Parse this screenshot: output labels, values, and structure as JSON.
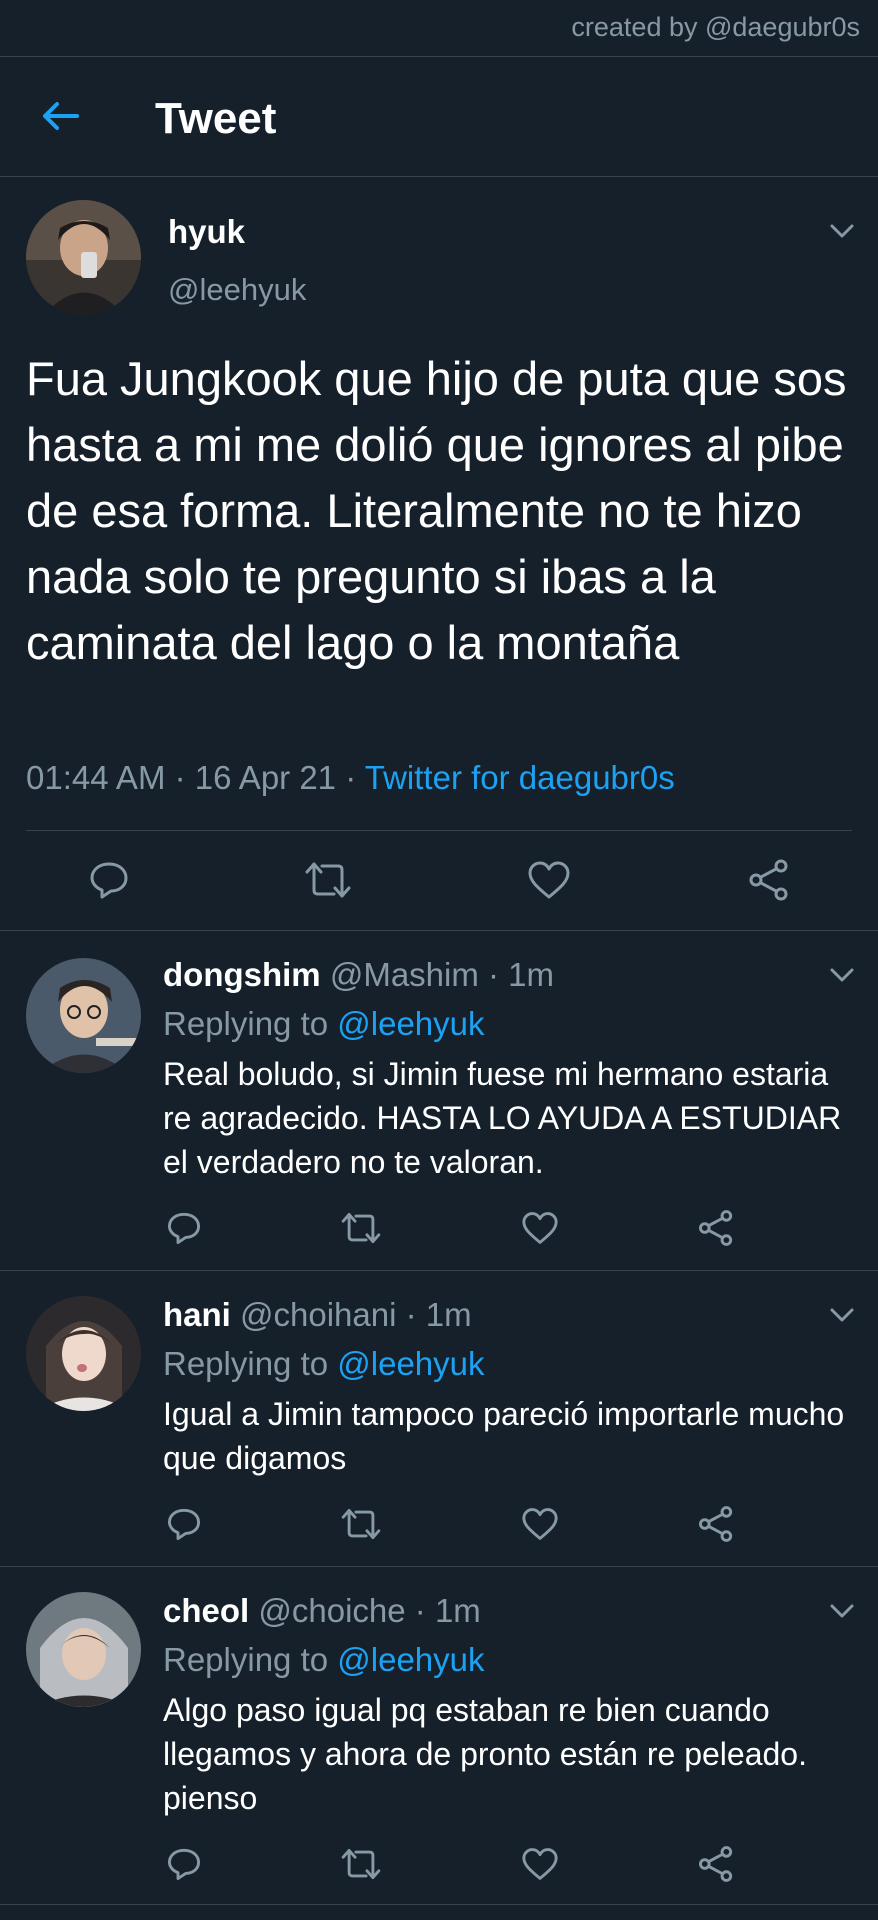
{
  "credit": "created by @daegubr0s",
  "header": {
    "title": "Tweet"
  },
  "main_tweet": {
    "name": "hyuk",
    "handle": "@leehyuk",
    "text": "Fua Jungkook que hijo de puta que sos hasta a mi me dolió que ignores al pibe de esa forma. Literalmente no te hizo nada solo te pregunto si ibas a la caminata del lago o la montaña",
    "time": "01:44 AM · 16 Apr 21 · ",
    "source": "Twitter for daegubr0s"
  },
  "replies": [
    {
      "name": "dongshim",
      "handle": "@Mashim · 1m",
      "replying_prefix": "Replying to ",
      "replying_to": "@leehyuk",
      "text": "Real boludo, si Jimin fuese mi hermano estaria re agradecido. HASTA LO AYUDA A ESTUDIAR el verdadero no te valoran."
    },
    {
      "name": "hani",
      "handle": "@choihani · 1m",
      "replying_prefix": "Replying to ",
      "replying_to": "@leehyuk",
      "text": "Igual a Jimin tampoco pareció importarle mucho que digamos"
    },
    {
      "name": "cheol",
      "handle": "@choiche · 1m",
      "replying_prefix": "Replying to ",
      "replying_to": "@leehyuk",
      "text": "Algo paso igual pq estaban re bien cuando llegamos y ahora de pronto están re peleado. pienso"
    }
  ],
  "colors": {
    "background": "#15202b",
    "accent": "#1da1f2",
    "secondary_text": "#8899a6",
    "divider": "#38444d"
  }
}
